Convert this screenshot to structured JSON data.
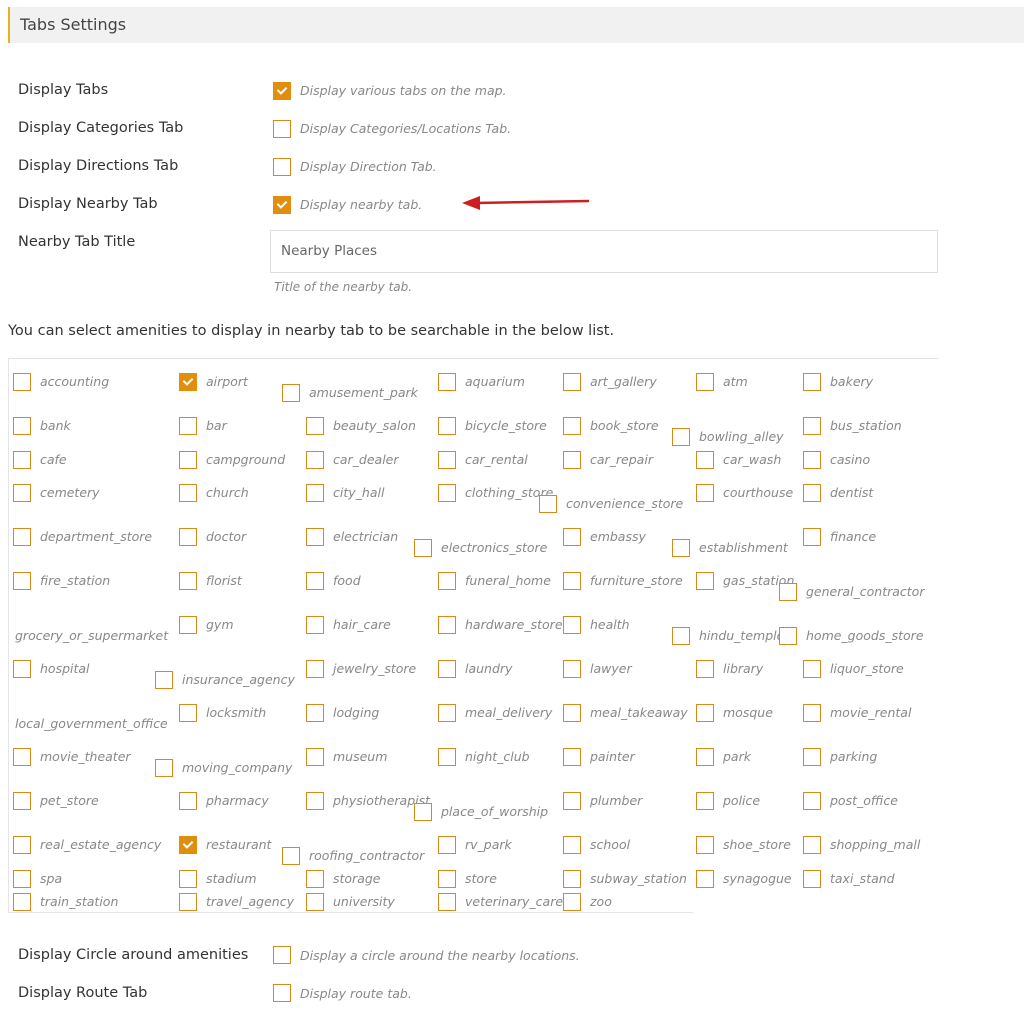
{
  "header": {
    "title": "Tabs Settings"
  },
  "settings": [
    {
      "label": "Display Tabs",
      "checked": true,
      "description": "Display various tabs on the map."
    },
    {
      "label": "Display Categories Tab",
      "checked": false,
      "description": "Display Categories/Locations Tab."
    },
    {
      "label": "Display Directions Tab",
      "checked": false,
      "description": "Display Direction Tab."
    },
    {
      "label": "Display Nearby Tab",
      "checked": true,
      "description": "Display nearby tab."
    }
  ],
  "nearby_title": {
    "label": "Nearby Tab Title",
    "value": "Nearby Places",
    "help": "Title of the nearby tab."
  },
  "amenities_intro": "You can select amenities to display in nearby tab to be searchable in the below list.",
  "amenities": [
    {
      "name": "accounting",
      "checked": false
    },
    {
      "name": "airport",
      "checked": true
    },
    {
      "name": "amusement_park",
      "checked": false
    },
    {
      "name": "aquarium",
      "checked": false
    },
    {
      "name": "art_gallery",
      "checked": false
    },
    {
      "name": "atm",
      "checked": false
    },
    {
      "name": "bakery",
      "checked": false
    },
    {
      "name": "bank",
      "checked": false
    },
    {
      "name": "bar",
      "checked": false
    },
    {
      "name": "beauty_salon",
      "checked": false
    },
    {
      "name": "bicycle_store",
      "checked": false
    },
    {
      "name": "book_store",
      "checked": false
    },
    {
      "name": "bowling_alley",
      "checked": false
    },
    {
      "name": "bus_station",
      "checked": false
    },
    {
      "name": "cafe",
      "checked": false
    },
    {
      "name": "campground",
      "checked": false
    },
    {
      "name": "car_dealer",
      "checked": false
    },
    {
      "name": "car_rental",
      "checked": false
    },
    {
      "name": "car_repair",
      "checked": false
    },
    {
      "name": "car_wash",
      "checked": false
    },
    {
      "name": "casino",
      "checked": false
    },
    {
      "name": "cemetery",
      "checked": false
    },
    {
      "name": "church",
      "checked": false
    },
    {
      "name": "city_hall",
      "checked": false
    },
    {
      "name": "clothing_store",
      "checked": false
    },
    {
      "name": "convenience_store",
      "checked": false
    },
    {
      "name": "courthouse",
      "checked": false
    },
    {
      "name": "dentist",
      "checked": false
    },
    {
      "name": "department_store",
      "checked": false
    },
    {
      "name": "doctor",
      "checked": false
    },
    {
      "name": "electrician",
      "checked": false
    },
    {
      "name": "electronics_store",
      "checked": false
    },
    {
      "name": "embassy",
      "checked": false
    },
    {
      "name": "establishment",
      "checked": false
    },
    {
      "name": "finance",
      "checked": false
    },
    {
      "name": "fire_station",
      "checked": false
    },
    {
      "name": "florist",
      "checked": false
    },
    {
      "name": "food",
      "checked": false
    },
    {
      "name": "funeral_home",
      "checked": false
    },
    {
      "name": "furniture_store",
      "checked": false
    },
    {
      "name": "gas_station",
      "checked": false
    },
    {
      "name": "general_contractor",
      "checked": false
    },
    {
      "name": "grocery_or_supermarket",
      "checked": false
    },
    {
      "name": "gym",
      "checked": false
    },
    {
      "name": "hair_care",
      "checked": false
    },
    {
      "name": "hardware_store",
      "checked": false
    },
    {
      "name": "health",
      "checked": false
    },
    {
      "name": "hindu_temple",
      "checked": false
    },
    {
      "name": "home_goods_store",
      "checked": false
    },
    {
      "name": "hospital",
      "checked": false
    },
    {
      "name": "insurance_agency",
      "checked": false
    },
    {
      "name": "jewelry_store",
      "checked": false
    },
    {
      "name": "laundry",
      "checked": false
    },
    {
      "name": "lawyer",
      "checked": false
    },
    {
      "name": "library",
      "checked": false
    },
    {
      "name": "liquor_store",
      "checked": false
    },
    {
      "name": "local_government_office",
      "checked": false
    },
    {
      "name": "locksmith",
      "checked": false
    },
    {
      "name": "lodging",
      "checked": false
    },
    {
      "name": "meal_delivery",
      "checked": false
    },
    {
      "name": "meal_takeaway",
      "checked": false
    },
    {
      "name": "mosque",
      "checked": false
    },
    {
      "name": "movie_rental",
      "checked": false
    },
    {
      "name": "movie_theater",
      "checked": false
    },
    {
      "name": "moving_company",
      "checked": false
    },
    {
      "name": "museum",
      "checked": false
    },
    {
      "name": "night_club",
      "checked": false
    },
    {
      "name": "painter",
      "checked": false
    },
    {
      "name": "park",
      "checked": false
    },
    {
      "name": "parking",
      "checked": false
    },
    {
      "name": "pet_store",
      "checked": false
    },
    {
      "name": "pharmacy",
      "checked": false
    },
    {
      "name": "physiotherapist",
      "checked": false
    },
    {
      "name": "place_of_worship",
      "checked": false
    },
    {
      "name": "plumber",
      "checked": false
    },
    {
      "name": "police",
      "checked": false
    },
    {
      "name": "post_office",
      "checked": false
    },
    {
      "name": "real_estate_agency",
      "checked": false
    },
    {
      "name": "restaurant",
      "checked": true
    },
    {
      "name": "roofing_contractor",
      "checked": false
    },
    {
      "name": "rv_park",
      "checked": false
    },
    {
      "name": "school",
      "checked": false
    },
    {
      "name": "shoe_store",
      "checked": false
    },
    {
      "name": "shopping_mall",
      "checked": false
    },
    {
      "name": "spa",
      "checked": false
    },
    {
      "name": "stadium",
      "checked": false
    },
    {
      "name": "storage",
      "checked": false
    },
    {
      "name": "store",
      "checked": false
    },
    {
      "name": "subway_station",
      "checked": false
    },
    {
      "name": "synagogue",
      "checked": false
    },
    {
      "name": "taxi_stand",
      "checked": false
    },
    {
      "name": "train_station",
      "checked": false
    },
    {
      "name": "travel_agency",
      "checked": false
    },
    {
      "name": "university",
      "checked": false
    },
    {
      "name": "veterinary_care",
      "checked": false
    },
    {
      "name": "zoo",
      "checked": false
    }
  ],
  "bottom_settings": [
    {
      "label": "Display Circle around amenities",
      "checked": false,
      "description": "Display a circle around the nearby locations."
    },
    {
      "label": "Display Route Tab",
      "checked": false,
      "description": "Display route tab."
    }
  ],
  "colors": {
    "accent": "#e08e0b",
    "checkbox_border": "#d9891a",
    "annotation_arrow": "#cc1f1f"
  }
}
